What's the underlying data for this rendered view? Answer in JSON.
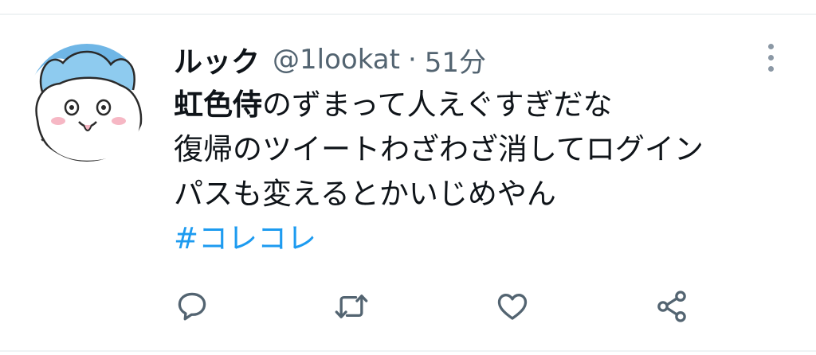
{
  "tweet": {
    "display_name": "ルック",
    "handle": "@1lookat",
    "separator": "·",
    "timestamp": "51分",
    "text": {
      "line1_bold": "虹色侍",
      "line1_rest": "のずまって人えぐすぎだな",
      "line2": "復帰のツイートわざわざ消してログイン",
      "line3": "パスも変えるとかいじめやん",
      "hashtag": "#コレコレ"
    }
  },
  "actions": {
    "reply_icon": "speech-bubble-icon",
    "retweet_icon": "retweet-arrows-icon",
    "like_icon": "heart-icon",
    "share_icon": "share-nodes-icon"
  },
  "colors": {
    "text": "#0f1419",
    "secondary": "#536471",
    "hashtag": "#1d9bf0",
    "avatar_hat": "#6fb6e6"
  }
}
